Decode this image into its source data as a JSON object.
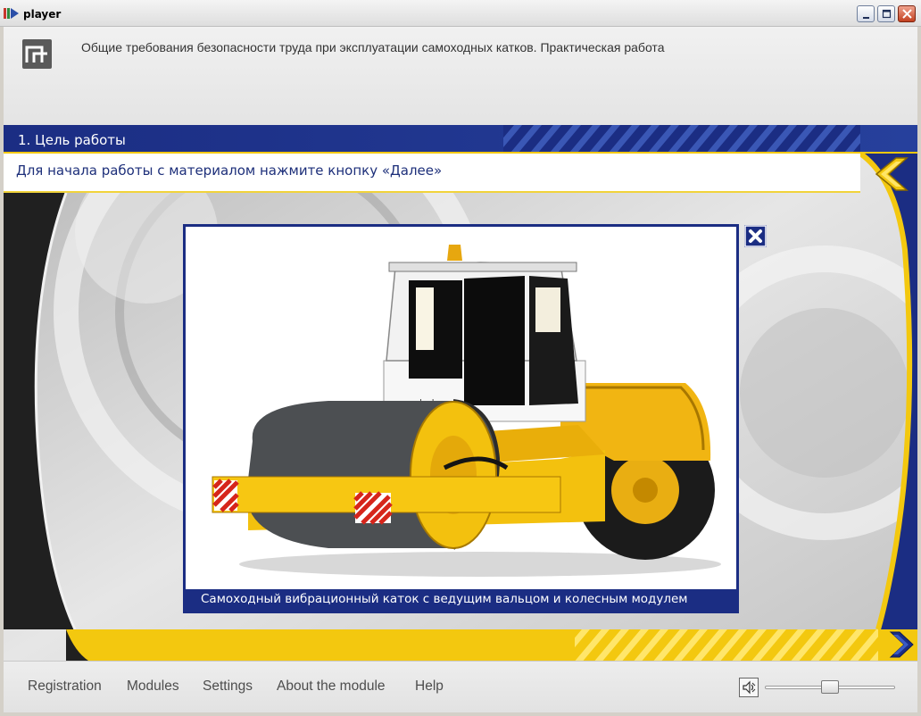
{
  "window": {
    "title": "player"
  },
  "course": {
    "title": "Общие требования безопасности труда при эксплуатации самоходных катков. Практическая работа"
  },
  "section": {
    "label": "1. Цель работы"
  },
  "instruction": {
    "text": "Для начала работы с материалом нажмите кнопку «Далее»"
  },
  "popup": {
    "caption": "Самоходный вибрационный каток с ведущим вальцом и колесным модулем",
    "image_subject": "yellow self-propelled vibratory road roller",
    "cab_brand_label": "amkodor"
  },
  "menu": {
    "items": [
      "Registration",
      "Modules",
      "Settings",
      "About the module",
      "Help"
    ]
  },
  "volume": {
    "level": 0.5
  },
  "icons": {
    "app": "player-app-icon",
    "minimize": "minimize-icon",
    "maximize": "maximize-icon",
    "close": "close-icon",
    "back": "back-arrow-icon",
    "next": "next-arrow-icon",
    "popup_close": "popup-close-icon",
    "volume": "speaker-icon"
  },
  "colors": {
    "accent_blue": "#1b2d83",
    "accent_yellow": "#f3c80f",
    "instruction_text": "#1d2f7a",
    "window_close": "#c2401f"
  }
}
